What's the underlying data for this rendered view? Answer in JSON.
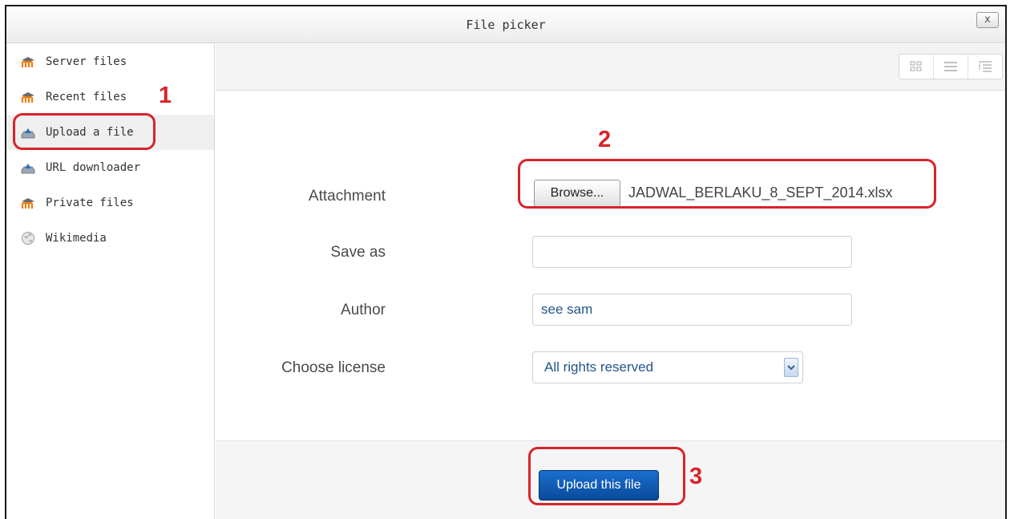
{
  "window": {
    "title": "File picker",
    "close_label": "x"
  },
  "sidebar": {
    "items": [
      {
        "label": "Server files",
        "icon": "moodle-icon"
      },
      {
        "label": "Recent files",
        "icon": "moodle-icon"
      },
      {
        "label": "Upload a file",
        "icon": "upload-icon",
        "active": true
      },
      {
        "label": "URL downloader",
        "icon": "upload-icon"
      },
      {
        "label": "Private files",
        "icon": "moodle-icon"
      },
      {
        "label": "Wikimedia",
        "icon": "wikimedia-globe-icon"
      }
    ]
  },
  "toolbar": {
    "views": [
      "icons-view",
      "list-view",
      "tree-view"
    ]
  },
  "form": {
    "attachment_label": "Attachment",
    "browse_label": "Browse...",
    "selected_file": "JADWAL_BERLAKU_8_SEPT_2014.xlsx",
    "saveas_label": "Save as",
    "saveas_value": "",
    "author_label": "Author",
    "author_value": "see sam",
    "license_label": "Choose license",
    "license_value": "All rights reserved"
  },
  "footer": {
    "upload_label": "Upload this file"
  },
  "annotations": {
    "step1": "1",
    "step2": "2",
    "step3": "3",
    "color": "#d8232a"
  },
  "colors": {
    "primary_button": "#0a4a9a",
    "accent_text": "#22558a"
  }
}
